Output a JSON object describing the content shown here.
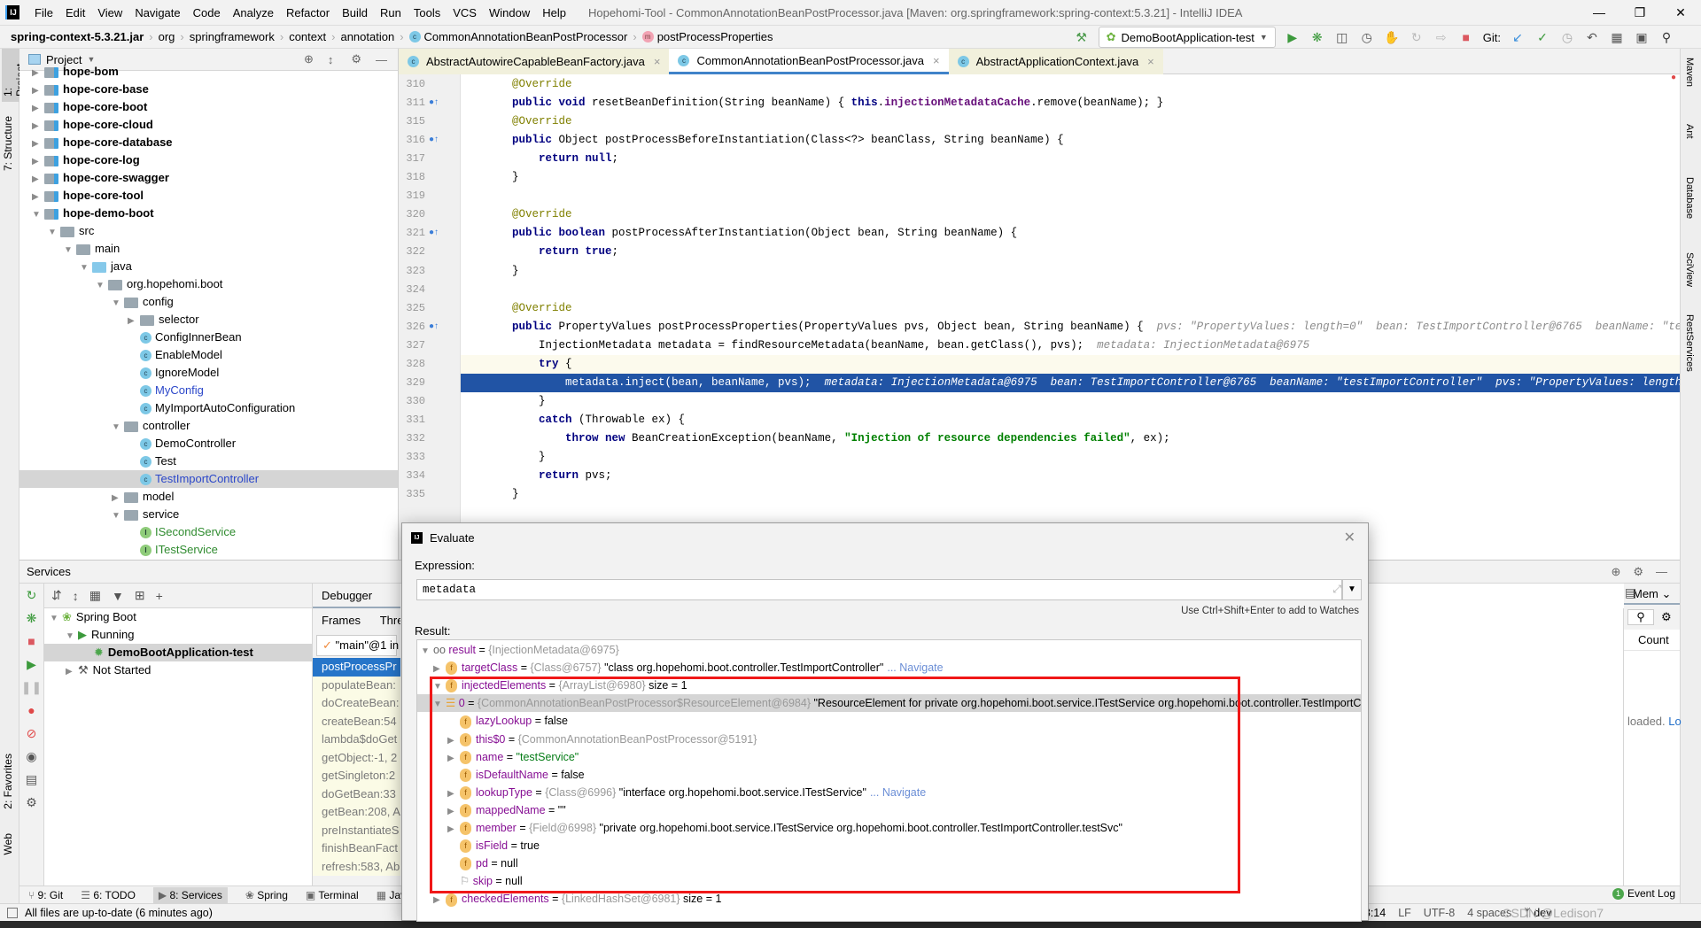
{
  "menu": {
    "items": [
      "File",
      "Edit",
      "View",
      "Navigate",
      "Code",
      "Analyze",
      "Refactor",
      "Build",
      "Run",
      "Tools",
      "VCS",
      "Window",
      "Help"
    ],
    "window_title": "Hopehomi-Tool - CommonAnnotationBeanPostProcessor.java [Maven: org.springframework:spring-context:5.3.21] - IntelliJ IDEA"
  },
  "breadcrumb": [
    "spring-context-5.3.21.jar",
    "org",
    "springframework",
    "context",
    "annotation",
    "CommonAnnotationBeanPostProcessor",
    "postProcessProperties"
  ],
  "toolbar": {
    "run_config": "DemoBootApplication-test",
    "git_label": "Git:"
  },
  "left_strip": {
    "project": "1: Project",
    "structure": "7: Structure",
    "favorites": "2: Favorites",
    "web": "Web"
  },
  "right_strip": [
    "Maven",
    "Ant",
    "Database",
    "SciView",
    "RestServices"
  ],
  "project": {
    "title": "Project",
    "items": [
      {
        "label": "hope-bom",
        "depth": 0,
        "kind": "module",
        "open": false
      },
      {
        "label": "hope-core-base",
        "depth": 0,
        "kind": "module",
        "open": false
      },
      {
        "label": "hope-core-boot",
        "depth": 0,
        "kind": "module",
        "open": false
      },
      {
        "label": "hope-core-cloud",
        "depth": 0,
        "kind": "module",
        "open": false
      },
      {
        "label": "hope-core-database",
        "depth": 0,
        "kind": "module",
        "open": false
      },
      {
        "label": "hope-core-log",
        "depth": 0,
        "kind": "module",
        "open": false
      },
      {
        "label": "hope-core-swagger",
        "depth": 0,
        "kind": "module",
        "open": false
      },
      {
        "label": "hope-core-tool",
        "depth": 0,
        "kind": "module",
        "open": false
      },
      {
        "label": "hope-demo-boot",
        "depth": 0,
        "kind": "module",
        "open": true
      },
      {
        "label": "src",
        "depth": 1,
        "kind": "folder",
        "open": true
      },
      {
        "label": "main",
        "depth": 2,
        "kind": "folder",
        "open": true
      },
      {
        "label": "java",
        "depth": 3,
        "kind": "java",
        "open": true
      },
      {
        "label": "org.hopehomi.boot",
        "depth": 4,
        "kind": "package",
        "open": true
      },
      {
        "label": "config",
        "depth": 5,
        "kind": "package",
        "open": true
      },
      {
        "label": "selector",
        "depth": 6,
        "kind": "package",
        "open": false
      },
      {
        "label": "ConfigInnerBean",
        "depth": 6,
        "kind": "class"
      },
      {
        "label": "EnableModel",
        "depth": 6,
        "kind": "class"
      },
      {
        "label": "IgnoreModel",
        "depth": 6,
        "kind": "class"
      },
      {
        "label": "MyConfig",
        "depth": 6,
        "kind": "class",
        "modified": true
      },
      {
        "label": "MyImportAutoConfiguration",
        "depth": 6,
        "kind": "class"
      },
      {
        "label": "controller",
        "depth": 5,
        "kind": "package",
        "open": true
      },
      {
        "label": "DemoController",
        "depth": 6,
        "kind": "class"
      },
      {
        "label": "Test",
        "depth": 6,
        "kind": "class"
      },
      {
        "label": "TestImportController",
        "depth": 6,
        "kind": "class",
        "modified": true,
        "selected": true
      },
      {
        "label": "model",
        "depth": 5,
        "kind": "package",
        "open": false
      },
      {
        "label": "service",
        "depth": 5,
        "kind": "package",
        "open": true
      },
      {
        "label": "ISecondService",
        "depth": 6,
        "kind": "interface"
      },
      {
        "label": "ITestService",
        "depth": 6,
        "kind": "interface"
      }
    ]
  },
  "tabs": [
    {
      "label": "AbstractAutowireCapableBeanFactory.java",
      "state": "pinned"
    },
    {
      "label": "CommonAnnotationBeanPostProcessor.java",
      "state": "active"
    },
    {
      "label": "AbstractApplicationContext.java",
      "state": "pinned"
    }
  ],
  "code": [
    {
      "n": "310",
      "t": [
        [
          "an",
          "    @Override"
        ]
      ]
    },
    {
      "n": "311",
      "g": "override",
      "t": [
        [
          "k",
          "    public void "
        ],
        [
          "fn",
          "resetBeanDefinition(String beanName) { "
        ],
        [
          "k",
          "this"
        ],
        [
          "fn",
          "."
        ],
        [
          "fld",
          "injectionMetadataCache"
        ],
        [
          "fn",
          ".remove(beanName); }"
        ]
      ]
    },
    {
      "n": "315",
      "t": [
        [
          "an",
          "    @Override"
        ]
      ]
    },
    {
      "n": "316",
      "g": "override",
      "t": [
        [
          "k",
          "    public "
        ],
        [
          "fn",
          "Object postProcessBeforeInstantiation(Class<?> beanClass, String beanName) {"
        ]
      ]
    },
    {
      "n": "317",
      "t": [
        [
          "k",
          "        return null"
        ],
        [
          "fn",
          ";"
        ]
      ]
    },
    {
      "n": "318",
      "t": [
        [
          "fn",
          "    }"
        ]
      ]
    },
    {
      "n": "319",
      "t": []
    },
    {
      "n": "320",
      "t": [
        [
          "an",
          "    @Override"
        ]
      ]
    },
    {
      "n": "321",
      "g": "override",
      "t": [
        [
          "k",
          "    public boolean "
        ],
        [
          "fn",
          "postProcessAfterInstantiation(Object bean, String beanName) {"
        ]
      ]
    },
    {
      "n": "322",
      "t": [
        [
          "k",
          "        return true"
        ],
        [
          "fn",
          ";"
        ]
      ]
    },
    {
      "n": "323",
      "t": [
        [
          "fn",
          "    }"
        ]
      ]
    },
    {
      "n": "324",
      "t": []
    },
    {
      "n": "325",
      "t": [
        [
          "an",
          "    @Override"
        ]
      ]
    },
    {
      "n": "326",
      "g": "override",
      "t": [
        [
          "k",
          "    public "
        ],
        [
          "fn",
          "PropertyValues postProcessProperties(PropertyValues pvs, Object bean, String beanName) {  "
        ],
        [
          "hint",
          "pvs: \"PropertyValues: length=0\"  bean: TestImportController@6765  beanName: \"testImportController\""
        ]
      ]
    },
    {
      "n": "327",
      "t": [
        [
          "fn",
          "        InjectionMetadata metadata = findResourceMetadata(beanName, bean.getClass(), pvs);  "
        ],
        [
          "hint",
          "metadata: InjectionMetadata@6975"
        ]
      ]
    },
    {
      "n": "328",
      "cur": true,
      "t": [
        [
          "k",
          "        try "
        ],
        [
          "fn",
          "{"
        ]
      ]
    },
    {
      "n": "329",
      "hl": true,
      "t": [
        [
          "fn",
          "            metadata.inject(bean, beanName, pvs);  "
        ],
        [
          "hint",
          "metadata: InjectionMetadata@6975  bean: TestImportController@6765  beanName: \"testImportController\"  pvs: \"PropertyValues: length=0\""
        ]
      ]
    },
    {
      "n": "330",
      "t": [
        [
          "fn",
          "        }"
        ]
      ]
    },
    {
      "n": "331",
      "t": [
        [
          "k",
          "        catch "
        ],
        [
          "fn",
          "(Throwable ex) {"
        ]
      ]
    },
    {
      "n": "332",
      "t": [
        [
          "k",
          "            throw new "
        ],
        [
          "fn",
          "BeanCreationException(beanName, "
        ],
        [
          "s",
          "\"Injection of resource dependencies failed\""
        ],
        [
          "fn",
          ", ex);"
        ]
      ]
    },
    {
      "n": "333",
      "t": [
        [
          "fn",
          "        }"
        ]
      ]
    },
    {
      "n": "334",
      "t": [
        [
          "k",
          "        return "
        ],
        [
          "fn",
          "pvs;"
        ]
      ]
    },
    {
      "n": "335",
      "t": [
        [
          "fn",
          "    }"
        ]
      ]
    }
  ],
  "services": {
    "title": "Services",
    "tree": [
      {
        "label": "Spring Boot",
        "depth": 0,
        "open": true
      },
      {
        "label": "Running",
        "depth": 1,
        "open": true
      },
      {
        "label": "DemoBootApplication-test",
        "depth": 2,
        "selected": true
      },
      {
        "label": "Not Started",
        "depth": 1,
        "open": false
      }
    ],
    "debugger_tab": "Debugger",
    "frames_tab": "Frames",
    "threads_tab": "Threa",
    "thread": "\"main\"@1 in",
    "frames": [
      "postProcessPr",
      "populateBean:",
      "doCreateBean:",
      "createBean:54",
      "lambda$doGet",
      "getObject:-1, 2",
      "getSingleton:2",
      "doGetBean:33",
      "getBean:208, A",
      "preInstantiateS",
      "finishBeanFact",
      "refresh:583, Ab"
    ],
    "mem_tab": "Mem",
    "count_col": "Count",
    "loaded_text": "loaded.",
    "load_link": "Lo"
  },
  "bottom_tools": [
    {
      "label": "9: Git"
    },
    {
      "label": "6: TODO"
    },
    {
      "label": "8: Services",
      "active": true
    },
    {
      "label": "Spring"
    },
    {
      "label": "Terminal"
    },
    {
      "label": "Jav"
    }
  ],
  "event_log": {
    "label": "Event Log",
    "count": "1"
  },
  "status": {
    "message": "All files are up-to-date (6 minutes ago)",
    "position": "328:14",
    "line_sep": "LF",
    "encoding": "UTF-8",
    "indent": "4 spaces",
    "branch": "dev"
  },
  "evaluate": {
    "title": "Evaluate",
    "expression_label": "Expression:",
    "expression": "metadata",
    "watch_hint": "Use Ctrl+Shift+Enter to add to Watches",
    "result_label": "Result:",
    "rows": [
      {
        "depth": 0,
        "open": true,
        "icon": "watch",
        "name": "result",
        "type": "{InjectionMetadata@6975}",
        "value": ""
      },
      {
        "depth": 1,
        "open": false,
        "icon": "field",
        "name": "targetClass",
        "type": "{Class@6757}",
        "value": "\"class org.hopehomi.boot.controller.TestImportController\"",
        "nav": "... Navigate"
      },
      {
        "depth": 1,
        "open": true,
        "icon": "field",
        "name": "injectedElements",
        "type": "{ArrayList@6980}",
        "value": " size = 1"
      },
      {
        "depth": 2,
        "open": true,
        "icon": "array",
        "name": "0",
        "type": "{CommonAnnotationBeanPostProcessor$ResourceElement@6984}",
        "value": "\"ResourceElement for private org.hopehomi.boot.service.ITestService org.hopehomi.boot.controller.TestImportController.testSvc\"",
        "selected": true
      },
      {
        "depth": 3,
        "leaf": true,
        "icon": "field",
        "name": "lazyLookup",
        "type": "",
        "value": "false"
      },
      {
        "depth": 3,
        "open": false,
        "icon": "field",
        "name": "this$0",
        "type": "{CommonAnnotationBeanPostProcessor@5191}",
        "value": ""
      },
      {
        "depth": 3,
        "open": false,
        "icon": "field",
        "name": "name",
        "type": "",
        "value": "\"testService\"",
        "str": true
      },
      {
        "depth": 3,
        "leaf": true,
        "icon": "field",
        "name": "isDefaultName",
        "type": "",
        "value": "false"
      },
      {
        "depth": 3,
        "open": false,
        "icon": "field",
        "name": "lookupType",
        "type": "{Class@6996}",
        "value": "\"interface org.hopehomi.boot.service.ITestService\"",
        "nav": "... Navigate"
      },
      {
        "depth": 3,
        "open": false,
        "icon": "field",
        "name": "mappedName",
        "type": "",
        "value": "\"\""
      },
      {
        "depth": 3,
        "open": false,
        "icon": "field",
        "name": "member",
        "type": "{Field@6998}",
        "value": "\"private org.hopehomi.boot.service.ITestService org.hopehomi.boot.controller.TestImportController.testSvc\""
      },
      {
        "depth": 3,
        "leaf": true,
        "icon": "field",
        "name": "isField",
        "type": "",
        "value": "true"
      },
      {
        "depth": 3,
        "leaf": true,
        "icon": "field",
        "name": "pd",
        "type": "",
        "value": "null"
      },
      {
        "depth": 3,
        "leaf": true,
        "icon": "flag",
        "name": "skip",
        "type": "",
        "value": "null"
      },
      {
        "depth": 1,
        "open": false,
        "icon": "field",
        "name": "checkedElements",
        "type": "{LinkedHashSet@6981}",
        "value": " size = 1"
      }
    ]
  },
  "watermark": "CSDN @Ledison7",
  "colors": {
    "highlight_line": "#2154a5",
    "selection_frame": "#2675c9",
    "annotation_box": "#f01818",
    "accent": "#4083c9"
  }
}
